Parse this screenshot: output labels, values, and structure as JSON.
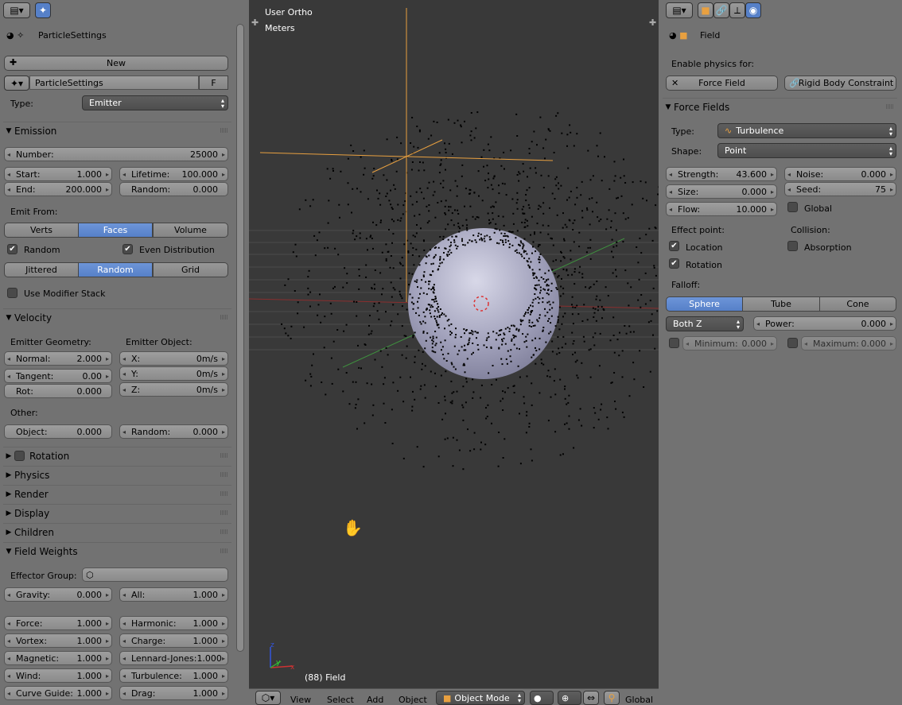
{
  "left": {
    "title": "ParticleSettings",
    "new_label": "New",
    "settings_name": "ParticleSettings",
    "fake_user": "F",
    "type_label": "Type:",
    "type_value": "Emitter",
    "emission": {
      "header": "Emission",
      "number_label": "Number:",
      "number_value": "25000",
      "start_label": "Start:",
      "start_value": "1.000",
      "end_label": "End:",
      "end_value": "200.000",
      "lifetime_label": "Lifetime:",
      "lifetime_value": "100.000",
      "random_label": "Random:",
      "random_value": "0.000",
      "emit_from": "Emit From:",
      "verts": "Verts",
      "faces": "Faces",
      "volume": "Volume",
      "random_chk": "Random",
      "even_dist": "Even Distribution",
      "jittered": "Jittered",
      "random_btn": "Random",
      "grid": "Grid",
      "use_modifier": "Use Modifier Stack"
    },
    "velocity": {
      "header": "Velocity",
      "emitter_geometry": "Emitter Geometry:",
      "emitter_object": "Emitter Object:",
      "normal_label": "Normal:",
      "normal_value": "2.000",
      "tangent_label": "Tangent:",
      "tangent_value": "0.00",
      "rot_label": "Rot:",
      "rot_value": "0.000",
      "x_label": "X:",
      "x_value": "0m/s",
      "y_label": "Y:",
      "y_value": "0m/s",
      "z_label": "Z:",
      "z_value": "0m/s",
      "other": "Other:",
      "object_label": "Object:",
      "object_value": "0.000",
      "random_label": "Random:",
      "random_value": "0.000"
    },
    "collapsed": [
      "Rotation",
      "Physics",
      "Render",
      "Display",
      "Children"
    ],
    "field_weights": {
      "header": "Field Weights",
      "effector_group": "Effector Group:",
      "gravity_label": "Gravity:",
      "gravity_value": "0.000",
      "all_label": "All:",
      "all_value": "1.000",
      "rows": [
        [
          "Force:",
          "1.000",
          "Harmonic:",
          "1.000"
        ],
        [
          "Vortex:",
          "1.000",
          "Charge:",
          "1.000"
        ],
        [
          "Magnetic:",
          "1.000",
          "Lennard-Jones:",
          "1.000"
        ],
        [
          "Wind:",
          "1.000",
          "Turbulence:",
          "1.000"
        ],
        [
          "Curve Guide:",
          "1.000",
          "Drag:",
          "1.000"
        ]
      ]
    }
  },
  "viewport": {
    "view_name": "User Ortho",
    "units": "Meters",
    "object_label": "(88) Field",
    "axis_x": "x",
    "axis_y": "y",
    "axis_z": "z",
    "menu": {
      "view": "View",
      "select": "Select",
      "add": "Add",
      "object": "Object",
      "mode": "Object Mode",
      "orientation": "Global"
    }
  },
  "right": {
    "title": "Field",
    "enable_physics": "Enable physics for:",
    "force_field_btn": "Force Field",
    "rigid_body_btn": "Rigid Body Constraint",
    "force_fields": {
      "header": "Force Fields",
      "type_label": "Type:",
      "type_value": "Turbulence",
      "shape_label": "Shape:",
      "shape_value": "Point",
      "strength_label": "Strength:",
      "strength_value": "43.600",
      "noise_label": "Noise:",
      "noise_value": "0.000",
      "size_label": "Size:",
      "size_value": "0.000",
      "seed_label": "Seed:",
      "seed_value": "75",
      "flow_label": "Flow:",
      "flow_value": "10.000",
      "global": "Global",
      "effect_point": "Effect point:",
      "collision": "Collision:",
      "location": "Location",
      "absorption": "Absorption",
      "rotation": "Rotation",
      "falloff": "Falloff:",
      "sphere": "Sphere",
      "tube": "Tube",
      "cone": "Cone",
      "falloff_axis": "Both Z",
      "power_label": "Power:",
      "power_value": "0.000",
      "minimum_label": "Minimum:",
      "minimum_value": "0.000",
      "maximum_label": "Maximum:",
      "maximum_value": "0.000"
    }
  },
  "colors": {
    "selected": "#5680c8",
    "viewport_bg": "#393939",
    "origin_orange": "#f0a030"
  }
}
